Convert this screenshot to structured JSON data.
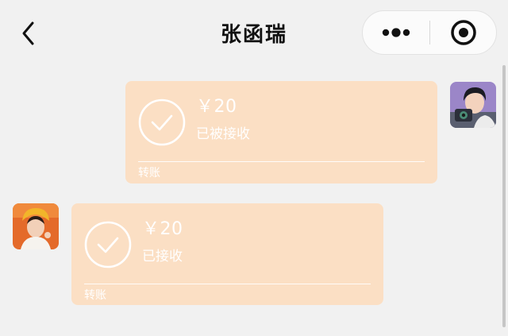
{
  "header": {
    "title": "张函瑞",
    "back_icon": "chevron-left-icon",
    "more_icon": "more-dots-icon",
    "close_icon": "target-close-icon"
  },
  "messages": [
    {
      "sender": "self",
      "type": "transfer",
      "amount": "￥20",
      "status": "已被接收",
      "label": "转账"
    },
    {
      "sender": "other",
      "type": "transfer",
      "amount": "￥20",
      "status": "已接收",
      "label": "转账"
    }
  ],
  "colors": {
    "background": "#f1f1f1",
    "bubble": "#fbdfc4",
    "bubble_text": "#ffffff"
  }
}
